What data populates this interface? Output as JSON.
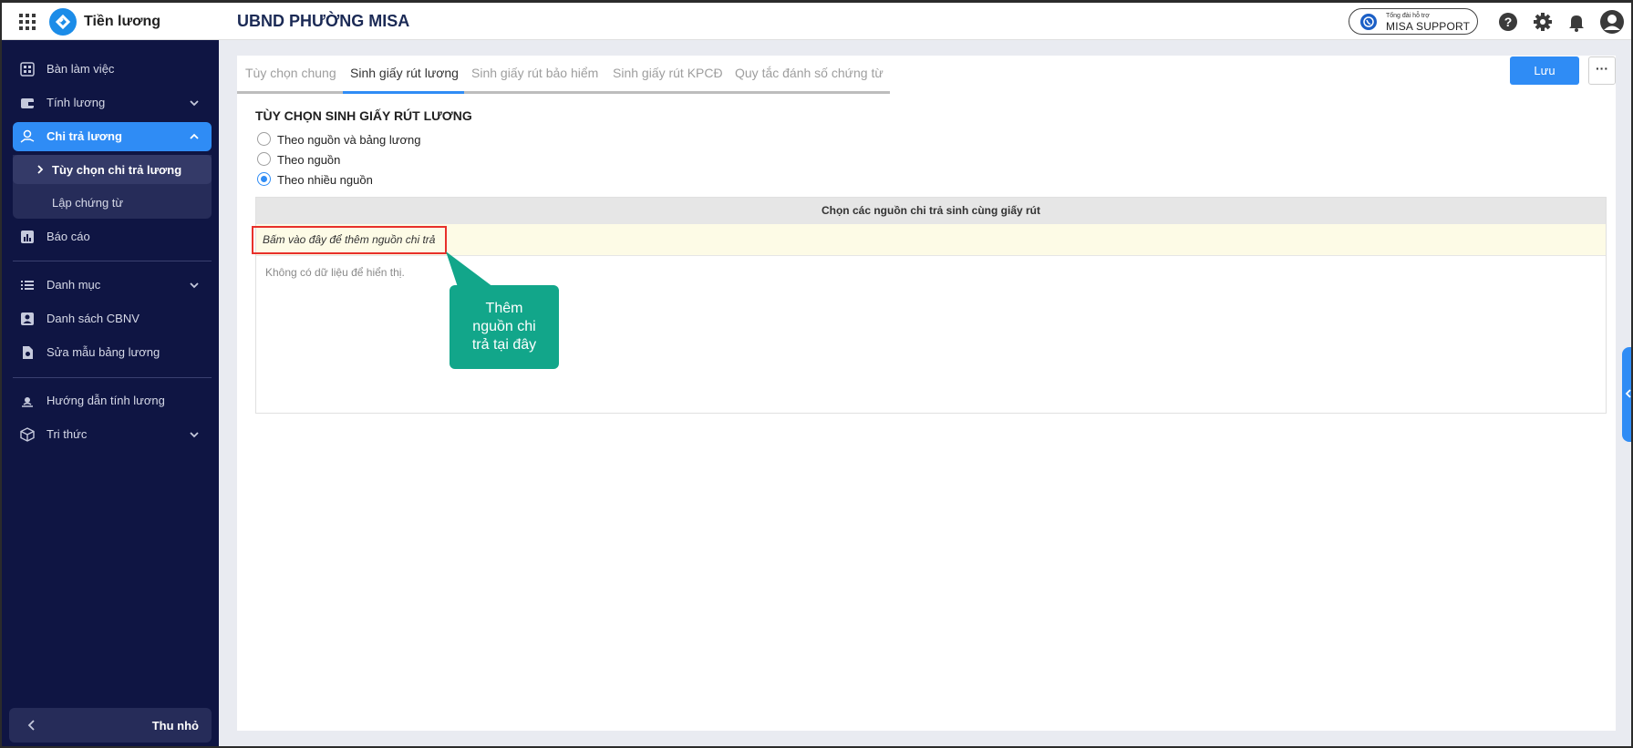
{
  "app": {
    "name": "Tiền lương",
    "org": "UBND PHƯỜNG MISA"
  },
  "support": {
    "small": "Tổng đài hỗ trợ",
    "big": "MISA SUPPORT"
  },
  "sidebar": {
    "items": [
      {
        "label": "Bàn làm việc",
        "icon": "dashboard-icon"
      },
      {
        "label": "Tính lương",
        "icon": "wallet-icon"
      },
      {
        "label": "Chi trả lương",
        "icon": "payout-icon"
      },
      {
        "label": "Báo cáo",
        "icon": "report-icon"
      },
      {
        "label": "Danh mục",
        "icon": "list-icon"
      },
      {
        "label": "Danh sách CBNV",
        "icon": "id-card-icon"
      },
      {
        "label": "Sửa mẫu bảng lương",
        "icon": "template-icon"
      },
      {
        "label": "Hướng dẫn tính lương",
        "icon": "guide-icon"
      },
      {
        "label": "Tri thức",
        "icon": "knowledge-icon"
      }
    ],
    "sub_items": [
      {
        "label": "Tùy chọn chi trả lương"
      },
      {
        "label": "Lập chứng từ"
      }
    ],
    "collapse_label": "Thu nhỏ"
  },
  "tabs": [
    {
      "label": "Tùy chọn chung"
    },
    {
      "label": "Sinh giấy rút lương"
    },
    {
      "label": "Sinh giấy rút bảo hiểm"
    },
    {
      "label": "Sinh giấy rút KPCĐ"
    },
    {
      "label": "Quy tắc đánh số chứng từ"
    }
  ],
  "toolbar": {
    "save_label": "Lưu",
    "more_label": "···"
  },
  "section": {
    "title": "TÙY CHỌN SINH GIẤY RÚT LƯƠNG",
    "options": [
      {
        "label": "Theo nguồn và bảng lương",
        "selected": false
      },
      {
        "label": "Theo nguồn",
        "selected": false
      },
      {
        "label": "Theo nhiều nguồn",
        "selected": true
      }
    ]
  },
  "grid": {
    "header": "Chọn các nguồn chi trả sinh cùng giấy rút",
    "add_link": "Bấm vào đây để thêm nguồn chi trả",
    "empty": "Không có dữ liệu để hiển thị."
  },
  "callout": {
    "line1": "Thêm",
    "line2": "nguồn chi",
    "line3": "trả tại đây"
  },
  "colors": {
    "accent": "#2f8cf5",
    "sidebar": "#0f1543",
    "callout": "#12a68a",
    "highlight_border": "#e8302a"
  }
}
